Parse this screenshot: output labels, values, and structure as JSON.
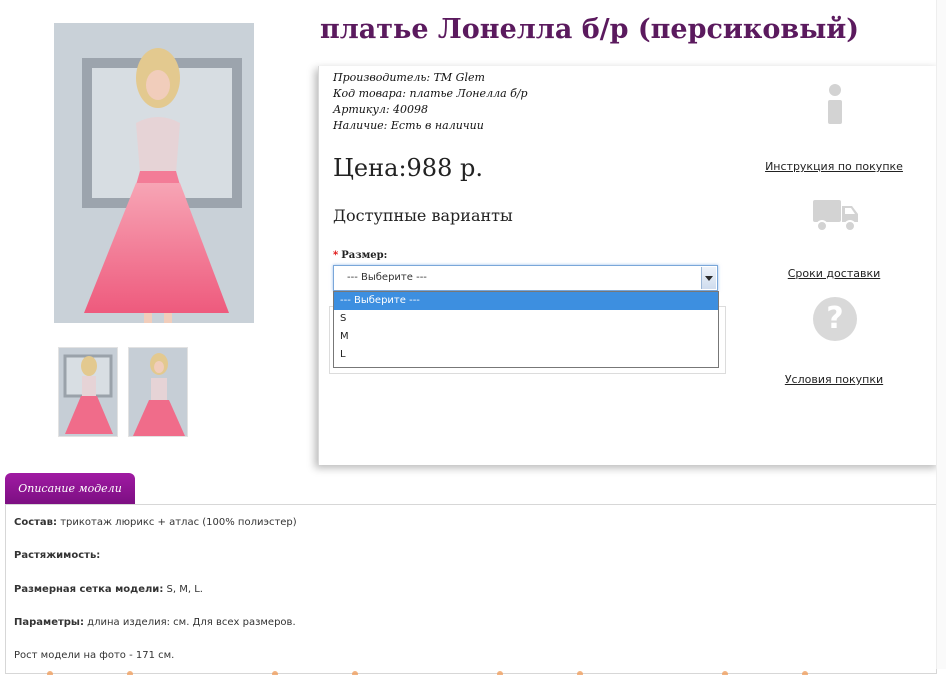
{
  "product": {
    "title": "платье Лонелла б/р (персиковый)",
    "meta": [
      {
        "key": "Производитель:",
        "value": "TM Glem"
      },
      {
        "key": "Код товара:",
        "value": "платье Лонелла б/р"
      },
      {
        "key": "Артикул:",
        "value": "40098"
      },
      {
        "key": "Наличие:",
        "value": "Есть в наличии"
      }
    ],
    "price": "Цена:988 р.",
    "variants_heading": "Доступные варианты",
    "size_label": "Размер:",
    "size_select": {
      "selected": "--- Выберите ---",
      "options": [
        "--- Выберите ---",
        "S",
        "M",
        "L"
      ]
    }
  },
  "side_links": {
    "instructions": "Инструкция по покупке",
    "delivery": "Сроки доставки",
    "conditions": "Условия покупки"
  },
  "icons": {
    "info": "info-icon",
    "truck": "truck-icon",
    "question": "question-icon"
  },
  "tabs": {
    "description": "Описание модели"
  },
  "description": {
    "composition_label": "Состав:",
    "composition_value": "трикотаж люрикс + атлас (100% полиэстер)",
    "stretch_label": "Растяжимость:",
    "sizes_label": "Размерная сетка модели:",
    "sizes_value": "S, M, L.",
    "params_label": "Параметры:",
    "params_value": "длина изделия: см. Для всех размеров.",
    "model_height": "Рост модели на фото - 171 см."
  },
  "colors": {
    "title": "#5b1a5e",
    "tab": "#8e1592",
    "select_highlight": "#3d8fe0",
    "dress": "#f06c8a"
  }
}
